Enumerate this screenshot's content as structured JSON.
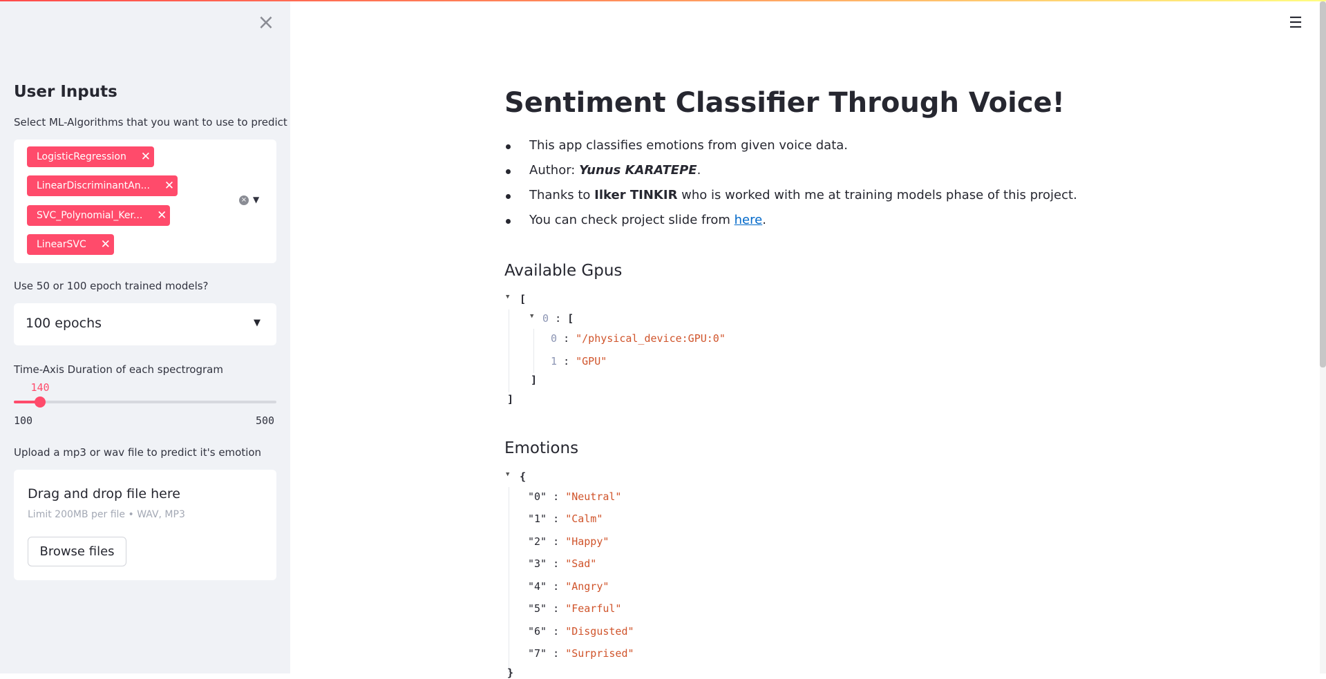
{
  "sidebar": {
    "close_glyph": "×",
    "heading": "User Inputs",
    "algorithms_label": "Select ML-Algorithms that you want to use to predict",
    "algorithms": [
      {
        "label": "LogisticRegression"
      },
      {
        "label": "LinearDiscriminantAn..."
      },
      {
        "label": "SVC_Polynomial_Ker..."
      },
      {
        "label": "LinearSVC"
      }
    ],
    "tag_remove_glyph": "✕",
    "epochs_label": "Use 50 or 100 epoch trained models?",
    "epochs_value": "100 epochs",
    "slider_label": "Time-Axis Duration of each spectrogram",
    "slider": {
      "value": 140,
      "min": 100,
      "max": 500,
      "value_text": "140",
      "min_text": "100",
      "max_text": "500"
    },
    "upload_label": "Upload a mp3 or wav file to predict it's emotion",
    "upload_title": "Drag and drop file here",
    "upload_limit": "Limit 200MB per file • WAV, MP3",
    "browse_label": "Browse files"
  },
  "main": {
    "title": "Sentiment Classifier Through Voice!",
    "bullets": {
      "b1": "This app classifies emotions from given voice data.",
      "b2_prefix": "Author: ",
      "b2_author": "Yunus KARATEPE",
      "b2_suffix": ".",
      "b3_prefix": "Thanks to ",
      "b3_name": "Ilker TINKIR",
      "b3_suffix": " who is worked with me at training models phase of this project.",
      "b4_prefix": "You can check project slide from ",
      "b4_link": "here",
      "b4_suffix": "."
    },
    "gpus_title": "Available Gpus",
    "gpus": {
      "open": "[",
      "close": "]",
      "item0_index": "0",
      "item0_open": "[",
      "item0_close": "]",
      "entries": [
        {
          "index": "0",
          "value": "\"/physical_device:GPU:0\""
        },
        {
          "index": "1",
          "value": "\"GPU\""
        }
      ]
    },
    "emotions_title": "Emotions",
    "emotions": {
      "open": "{",
      "close": "}",
      "entries": [
        {
          "key": "\"0\"",
          "value": "\"Neutral\""
        },
        {
          "key": "\"1\"",
          "value": "\"Calm\""
        },
        {
          "key": "\"2\"",
          "value": "\"Happy\""
        },
        {
          "key": "\"3\"",
          "value": "\"Sad\""
        },
        {
          "key": "\"4\"",
          "value": "\"Angry\""
        },
        {
          "key": "\"5\"",
          "value": "\"Fearful\""
        },
        {
          "key": "\"6\"",
          "value": "\"Disgusted\""
        },
        {
          "key": "\"7\"",
          "value": "\"Surprised\""
        }
      ]
    },
    "colon": ":"
  },
  "colors": {
    "accent": "#ff4b6b",
    "sidebar_bg": "#f0f2f6",
    "link": "#0068c9",
    "json_string": "#d0542b"
  },
  "icons": {
    "menu": "hamburger-menu-icon",
    "close": "close-icon",
    "caret": "chevron-down-icon",
    "clear": "clear-all-icon"
  }
}
